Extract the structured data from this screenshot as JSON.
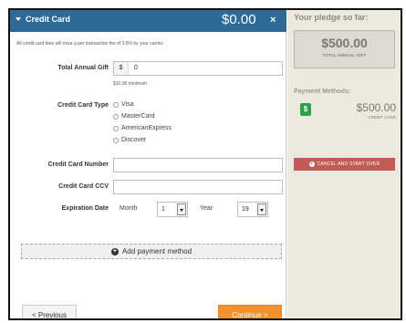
{
  "header": {
    "title": "Credit Card",
    "amount": "$0.00",
    "close_icon": "×"
  },
  "form": {
    "fee_note": "All credit card fees will incur a per transaction fee of 3.5% by your carrier.",
    "total_gift": {
      "label": "Total Annual Gift",
      "currency": "$",
      "value": "0",
      "min_note": "$10.00 minimum"
    },
    "card_type": {
      "label": "Credit Card Type",
      "options": [
        "Visa",
        "MasterCard",
        "AmericanExpress",
        "Discover"
      ]
    },
    "card_number": {
      "label": "Credit Card Number",
      "value": ""
    },
    "card_ccv": {
      "label": "Credit Card CCV",
      "value": ""
    },
    "expiration": {
      "label": "Expiration Date",
      "month_label": "Month",
      "month_value": "1",
      "year_label": "Year",
      "year_value": "19"
    },
    "add_payment": "Add payment method"
  },
  "footer": {
    "previous": "< Previous",
    "continue": "Continue >"
  },
  "sidebar": {
    "title": "Your pledge so far:",
    "pledge_amount": "$500.00",
    "pledge_sub": "TOTAL ANNUAL GIFT",
    "payment_methods_title": "Payment Methods:",
    "payment_icon": "$",
    "payment_amount": "$500.00",
    "payment_type": "CREDIT CARD",
    "cancel_label": "CANCEL AND START OVER"
  },
  "colors": {
    "header_blue": "#2e6a95",
    "continue_orange": "#f2922f",
    "cancel_red": "#c45a57",
    "payment_green": "#2fa04a",
    "sidebar_bg": "#ece9df"
  }
}
